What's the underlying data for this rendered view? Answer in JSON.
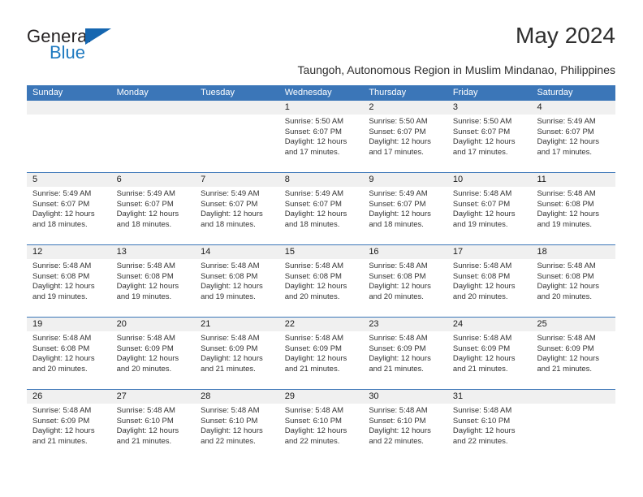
{
  "brand": {
    "name_top": "General",
    "name_bottom": "Blue",
    "triangle_color": "#1566b0",
    "blue_color": "#1f7ac0"
  },
  "header": {
    "title": "May 2024",
    "subtitle": "Taungoh, Autonomous Region in Muslim Mindanao, Philippines",
    "header_bg": "#3b76b8",
    "daynum_bg": "#f0f0f0"
  },
  "weekdays": [
    "Sunday",
    "Monday",
    "Tuesday",
    "Wednesday",
    "Thursday",
    "Friday",
    "Saturday"
  ],
  "weeks": [
    {
      "days": [
        {
          "num": "",
          "lines": []
        },
        {
          "num": "",
          "lines": []
        },
        {
          "num": "",
          "lines": []
        },
        {
          "num": "1",
          "lines": [
            "Sunrise: 5:50 AM",
            "Sunset: 6:07 PM",
            "Daylight: 12 hours",
            "and 17 minutes."
          ]
        },
        {
          "num": "2",
          "lines": [
            "Sunrise: 5:50 AM",
            "Sunset: 6:07 PM",
            "Daylight: 12 hours",
            "and 17 minutes."
          ]
        },
        {
          "num": "3",
          "lines": [
            "Sunrise: 5:50 AM",
            "Sunset: 6:07 PM",
            "Daylight: 12 hours",
            "and 17 minutes."
          ]
        },
        {
          "num": "4",
          "lines": [
            "Sunrise: 5:49 AM",
            "Sunset: 6:07 PM",
            "Daylight: 12 hours",
            "and 17 minutes."
          ]
        }
      ]
    },
    {
      "days": [
        {
          "num": "5",
          "lines": [
            "Sunrise: 5:49 AM",
            "Sunset: 6:07 PM",
            "Daylight: 12 hours",
            "and 18 minutes."
          ]
        },
        {
          "num": "6",
          "lines": [
            "Sunrise: 5:49 AM",
            "Sunset: 6:07 PM",
            "Daylight: 12 hours",
            "and 18 minutes."
          ]
        },
        {
          "num": "7",
          "lines": [
            "Sunrise: 5:49 AM",
            "Sunset: 6:07 PM",
            "Daylight: 12 hours",
            "and 18 minutes."
          ]
        },
        {
          "num": "8",
          "lines": [
            "Sunrise: 5:49 AM",
            "Sunset: 6:07 PM",
            "Daylight: 12 hours",
            "and 18 minutes."
          ]
        },
        {
          "num": "9",
          "lines": [
            "Sunrise: 5:49 AM",
            "Sunset: 6:07 PM",
            "Daylight: 12 hours",
            "and 18 minutes."
          ]
        },
        {
          "num": "10",
          "lines": [
            "Sunrise: 5:48 AM",
            "Sunset: 6:07 PM",
            "Daylight: 12 hours",
            "and 19 minutes."
          ]
        },
        {
          "num": "11",
          "lines": [
            "Sunrise: 5:48 AM",
            "Sunset: 6:08 PM",
            "Daylight: 12 hours",
            "and 19 minutes."
          ]
        }
      ]
    },
    {
      "days": [
        {
          "num": "12",
          "lines": [
            "Sunrise: 5:48 AM",
            "Sunset: 6:08 PM",
            "Daylight: 12 hours",
            "and 19 minutes."
          ]
        },
        {
          "num": "13",
          "lines": [
            "Sunrise: 5:48 AM",
            "Sunset: 6:08 PM",
            "Daylight: 12 hours",
            "and 19 minutes."
          ]
        },
        {
          "num": "14",
          "lines": [
            "Sunrise: 5:48 AM",
            "Sunset: 6:08 PM",
            "Daylight: 12 hours",
            "and 19 minutes."
          ]
        },
        {
          "num": "15",
          "lines": [
            "Sunrise: 5:48 AM",
            "Sunset: 6:08 PM",
            "Daylight: 12 hours",
            "and 20 minutes."
          ]
        },
        {
          "num": "16",
          "lines": [
            "Sunrise: 5:48 AM",
            "Sunset: 6:08 PM",
            "Daylight: 12 hours",
            "and 20 minutes."
          ]
        },
        {
          "num": "17",
          "lines": [
            "Sunrise: 5:48 AM",
            "Sunset: 6:08 PM",
            "Daylight: 12 hours",
            "and 20 minutes."
          ]
        },
        {
          "num": "18",
          "lines": [
            "Sunrise: 5:48 AM",
            "Sunset: 6:08 PM",
            "Daylight: 12 hours",
            "and 20 minutes."
          ]
        }
      ]
    },
    {
      "days": [
        {
          "num": "19",
          "lines": [
            "Sunrise: 5:48 AM",
            "Sunset: 6:08 PM",
            "Daylight: 12 hours",
            "and 20 minutes."
          ]
        },
        {
          "num": "20",
          "lines": [
            "Sunrise: 5:48 AM",
            "Sunset: 6:09 PM",
            "Daylight: 12 hours",
            "and 20 minutes."
          ]
        },
        {
          "num": "21",
          "lines": [
            "Sunrise: 5:48 AM",
            "Sunset: 6:09 PM",
            "Daylight: 12 hours",
            "and 21 minutes."
          ]
        },
        {
          "num": "22",
          "lines": [
            "Sunrise: 5:48 AM",
            "Sunset: 6:09 PM",
            "Daylight: 12 hours",
            "and 21 minutes."
          ]
        },
        {
          "num": "23",
          "lines": [
            "Sunrise: 5:48 AM",
            "Sunset: 6:09 PM",
            "Daylight: 12 hours",
            "and 21 minutes."
          ]
        },
        {
          "num": "24",
          "lines": [
            "Sunrise: 5:48 AM",
            "Sunset: 6:09 PM",
            "Daylight: 12 hours",
            "and 21 minutes."
          ]
        },
        {
          "num": "25",
          "lines": [
            "Sunrise: 5:48 AM",
            "Sunset: 6:09 PM",
            "Daylight: 12 hours",
            "and 21 minutes."
          ]
        }
      ]
    },
    {
      "days": [
        {
          "num": "26",
          "lines": [
            "Sunrise: 5:48 AM",
            "Sunset: 6:09 PM",
            "Daylight: 12 hours",
            "and 21 minutes."
          ]
        },
        {
          "num": "27",
          "lines": [
            "Sunrise: 5:48 AM",
            "Sunset: 6:10 PM",
            "Daylight: 12 hours",
            "and 21 minutes."
          ]
        },
        {
          "num": "28",
          "lines": [
            "Sunrise: 5:48 AM",
            "Sunset: 6:10 PM",
            "Daylight: 12 hours",
            "and 22 minutes."
          ]
        },
        {
          "num": "29",
          "lines": [
            "Sunrise: 5:48 AM",
            "Sunset: 6:10 PM",
            "Daylight: 12 hours",
            "and 22 minutes."
          ]
        },
        {
          "num": "30",
          "lines": [
            "Sunrise: 5:48 AM",
            "Sunset: 6:10 PM",
            "Daylight: 12 hours",
            "and 22 minutes."
          ]
        },
        {
          "num": "31",
          "lines": [
            "Sunrise: 5:48 AM",
            "Sunset: 6:10 PM",
            "Daylight: 12 hours",
            "and 22 minutes."
          ]
        },
        {
          "num": "",
          "lines": []
        }
      ]
    }
  ]
}
